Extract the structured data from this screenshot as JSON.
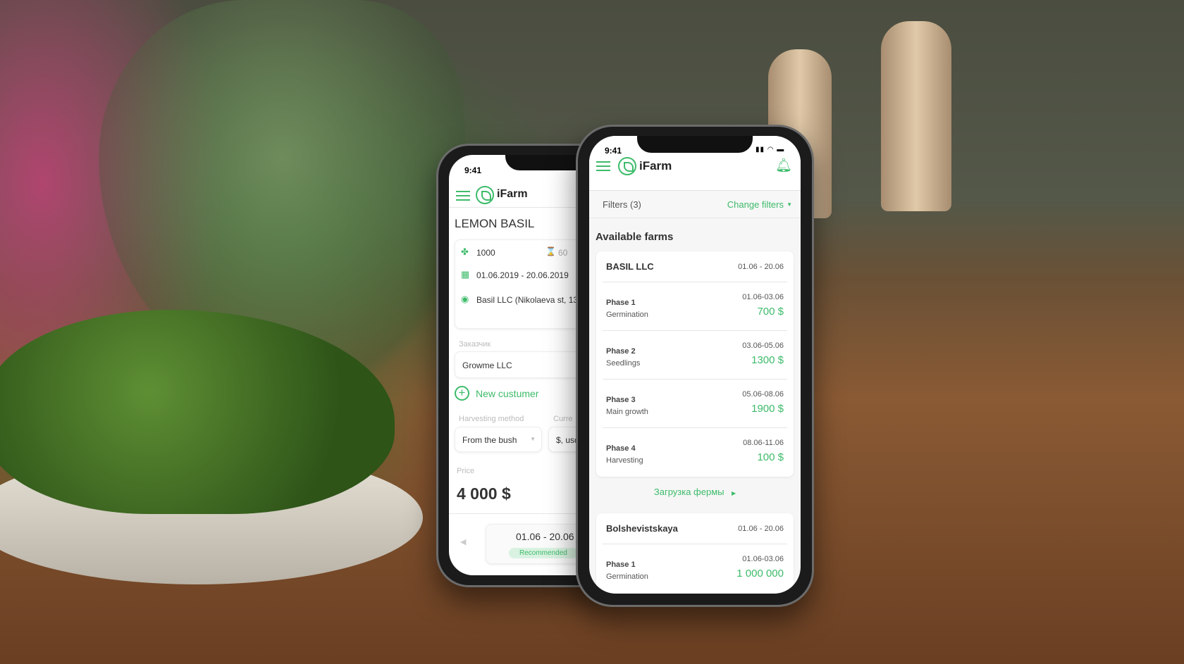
{
  "accent": "#3dbb6a",
  "back_phone": {
    "status_time": "9:41",
    "brand": "iFarm",
    "title": "LEMON BASIL",
    "info": {
      "quantity": "1000",
      "weight": "60",
      "dates": "01.06.2019 - 20.06.2019",
      "location": "Basil LLC (Nikolaeva st, 13"
    },
    "customer_label": "Заказчик",
    "customer_value": "Growme LLC",
    "new_customer": "New custumer",
    "harvest_label": "Harvesting method",
    "harvest_value": "From the bush",
    "currency_label": "Curre",
    "currency_value": "$, usd",
    "price_label": "Price",
    "price_value": "4 000 $",
    "period": "01.06 - 20.06",
    "badge": "Recommended"
  },
  "front_phone": {
    "status_time": "9:41",
    "brand": "iFarm",
    "filters": "Filters (3)",
    "change_filters": "Change filters",
    "section_title": "Available farms",
    "farms": [
      {
        "name": "BASIL LLC",
        "dates": "01.06 - 20.06",
        "phases": [
          {
            "phase": "Phase 1",
            "stage": "Germination",
            "dates": "01.06-03.06",
            "price": "700 $"
          },
          {
            "phase": "Phase 2",
            "stage": "Seedlings",
            "dates": "03.06-05.06",
            "price": "1300 $"
          },
          {
            "phase": "Phase 3",
            "stage": "Main growth",
            "dates": "05.06-08.06",
            "price": "1900 $"
          },
          {
            "phase": "Phase 4",
            "stage": "Harvesting",
            "dates": "08.06-11.06",
            "price": "100 $"
          }
        ]
      },
      {
        "name": "Bolshevistskaya",
        "dates": "01.06 - 20.06",
        "phases": [
          {
            "phase": "Phase 1",
            "stage": "Germination",
            "dates": "01.06-03.06",
            "price": "1 000 000"
          }
        ]
      }
    ],
    "load_farm": "Загрузка фермы"
  }
}
